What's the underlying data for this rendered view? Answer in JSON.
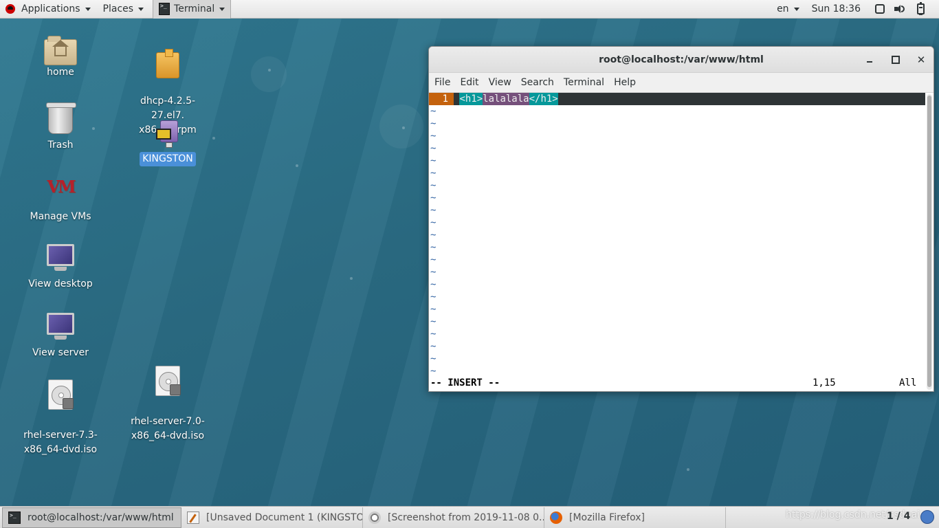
{
  "topbar": {
    "applications": "Applications",
    "places": "Places",
    "active_app": "Terminal",
    "lang": "en",
    "clock": "Sun 18:36"
  },
  "desktop_icons": [
    {
      "label": "home",
      "icon": "home-folder-icon"
    },
    {
      "label": "dhcp-4.2.5-27.el7.\nx86_64.rpm",
      "icon": "package-icon"
    },
    {
      "label": "Trash",
      "icon": "trash-icon"
    },
    {
      "label": "KINGSTON",
      "icon": "usb-drive-icon"
    },
    {
      "label": "Manage VMs",
      "icon": "vm-icon"
    },
    {
      "label": "View desktop",
      "icon": "monitor-icon"
    },
    {
      "label": "View server",
      "icon": "monitor-icon"
    },
    {
      "label": "rhel-server-7.3-\nx86_64-dvd.iso",
      "icon": "disc-image-icon"
    },
    {
      "label": "rhel-server-7.0-\nx86_64-dvd.iso",
      "icon": "disc-image-icon"
    }
  ],
  "terminal": {
    "title": "root@localhost:/var/www/html",
    "menus": [
      "File",
      "Edit",
      "View",
      "Search",
      "Terminal",
      "Help"
    ],
    "vim": {
      "line_number": "1",
      "open_tag": "<h1>",
      "content": "lalalala",
      "close_tag": "</h1>",
      "tilde": "~",
      "mode": "-- INSERT --",
      "position": "1,15",
      "scroll": "All"
    }
  },
  "taskbar": {
    "items": [
      {
        "label": "root@localhost:/var/www/html",
        "active": true
      },
      {
        "label": "[Unsaved Document 1 (KINGSTO...",
        "active": false
      },
      {
        "label": "[Screenshot from 2019-11-08 0...",
        "active": false
      },
      {
        "label": "[Mozilla Firefox]",
        "active": false
      }
    ],
    "watermark": "https://blog.csdn.net/csdnai",
    "workspace": "1 / 4"
  },
  "colors": {
    "desktop": "#2b6d84",
    "vim_line_bg": "#2e3436",
    "vim_linenr": "#c4620d",
    "vim_tag": "#06989a",
    "vim_content": "#75507b",
    "selection": "#4a90d9"
  }
}
